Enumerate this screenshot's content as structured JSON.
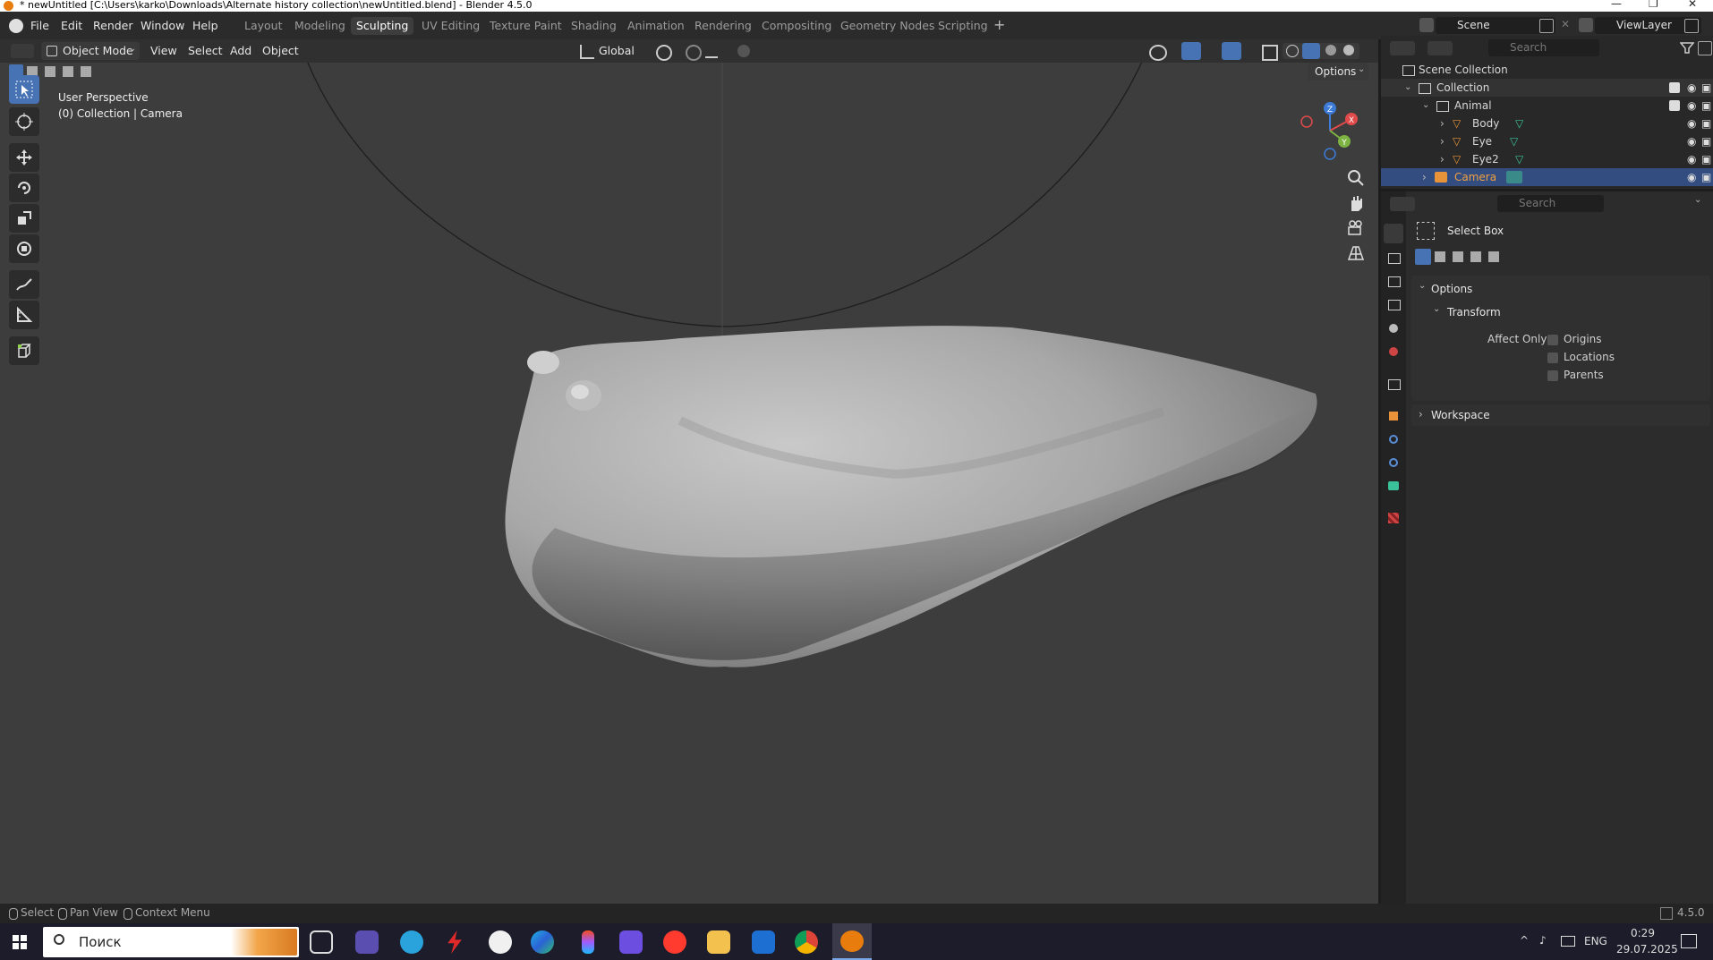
{
  "titlebar": {
    "title": "* newUntitled [C:\\Users\\karko\\Downloads\\Alternate history collection\\newUntitled.blend] - Blender 4.5.0"
  },
  "menu": [
    "File",
    "Edit",
    "Render",
    "Window",
    "Help"
  ],
  "workspaces": {
    "tabs": [
      "Layout",
      "Modeling",
      "Sculpting",
      "UV Editing",
      "Texture Paint",
      "Shading",
      "Animation",
      "Rendering",
      "Compositing",
      "Geometry Nodes",
      "Scripting"
    ],
    "active": "Sculpting"
  },
  "scene": {
    "name": "Scene",
    "view_layer": "ViewLayer"
  },
  "viewport_header": {
    "mode": "Object Mode",
    "menus": [
      "View",
      "Select",
      "Add",
      "Object"
    ],
    "transform_orientation": "Global",
    "options_label": "Options"
  },
  "viewport": {
    "perspective": "User Perspective",
    "context": "(0) Collection | Camera",
    "gizmo_axes": [
      "Z",
      "X",
      "Y"
    ]
  },
  "outliner": {
    "search_placeholder": "Search",
    "root": "Scene Collection",
    "rows": [
      {
        "label": "Collection",
        "depth": 1,
        "type": "collection"
      },
      {
        "label": "Animal",
        "depth": 2,
        "type": "collection"
      },
      {
        "label": "Body",
        "depth": 3,
        "type": "mesh"
      },
      {
        "label": "Eye",
        "depth": 3,
        "type": "mesh"
      },
      {
        "label": "Eye2",
        "depth": 3,
        "type": "mesh"
      },
      {
        "label": "Camera",
        "depth": 2,
        "type": "camera",
        "selected": true
      }
    ]
  },
  "properties": {
    "search_placeholder": "Search",
    "tool_name": "Select Box",
    "options_label": "Options",
    "transform_label": "Transform",
    "affect_only_label": "Affect Only",
    "checkboxes": [
      "Origins",
      "Locations",
      "Parents"
    ],
    "workspace_label": "Workspace"
  },
  "statusbar": {
    "hints": [
      "Select",
      "Pan View",
      "Context Menu"
    ],
    "version": "4.5.0"
  },
  "taskbar": {
    "search_placeholder": "Поиск",
    "language": "ENG",
    "time": "0:29",
    "date": "29.07.2025"
  },
  "colors": {
    "accent": "#4772b3",
    "viewport_bg": "#3d3d3d",
    "blender_orange": "#e87d0d",
    "selection": "#334d80"
  }
}
